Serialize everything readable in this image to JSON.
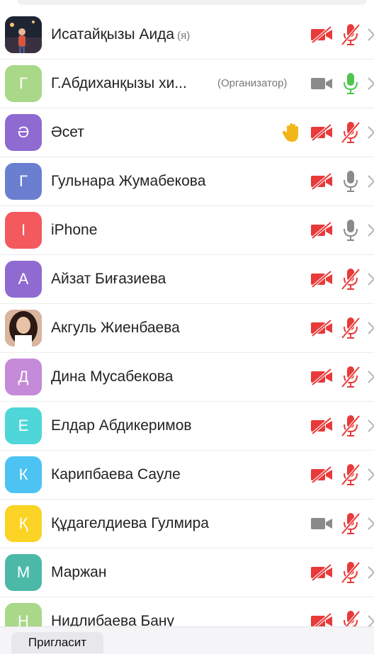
{
  "participants": [
    {
      "name": "Исатайқызы Аида",
      "tag": "(я)",
      "avatar_letter": "",
      "avatar_color": "#2a2f3d",
      "photo": true,
      "video": "off",
      "mic": "muted"
    },
    {
      "name": "Г.Абдиханқызы  хи...",
      "role": "(Организатор)",
      "avatar_letter": "Г",
      "avatar_color": "#a8d888",
      "video": "on",
      "mic": "active"
    },
    {
      "name": "Әсет",
      "avatar_letter": "Ә",
      "avatar_color": "#8e6ad1",
      "hand": true,
      "video": "off",
      "mic": "muted"
    },
    {
      "name": "Гульнара Жумабекова",
      "avatar_letter": "Г",
      "avatar_color": "#6b7fd1",
      "video": "off",
      "mic": "on"
    },
    {
      "name": "iPhone",
      "avatar_letter": "I",
      "avatar_color": "#f4595e",
      "video": "off",
      "mic": "on"
    },
    {
      "name": "Айзат Биғазиева",
      "avatar_letter": "А",
      "avatar_color": "#8e6ad1",
      "video": "off",
      "mic": "muted"
    },
    {
      "name": "Акгуль Жиенбаева",
      "avatar_letter": "",
      "avatar_color": "#c99a82",
      "photo": true,
      "video": "off",
      "mic": "muted"
    },
    {
      "name": "Дина Мусабекова",
      "avatar_letter": "Д",
      "avatar_color": "#c58ad8",
      "video": "off",
      "mic": "muted"
    },
    {
      "name": "Елдар Абдикеримов",
      "avatar_letter": "Е",
      "avatar_color": "#4fd6d8",
      "video": "off",
      "mic": "muted"
    },
    {
      "name": "Карипбаева Сауле",
      "avatar_letter": "К",
      "avatar_color": "#4cc3f2",
      "video": "off",
      "mic": "muted"
    },
    {
      "name": "Құдагелдиева Гулмира",
      "avatar_letter": "Қ",
      "avatar_color": "#fbd324",
      "video": "on",
      "mic": "muted"
    },
    {
      "name": "Маржан",
      "avatar_letter": "М",
      "avatar_color": "#4cb8a8",
      "video": "off",
      "mic": "muted"
    },
    {
      "name": "Нидлибаева Бану",
      "avatar_letter": "Н",
      "avatar_color": "#a8d888",
      "video": "off",
      "mic": "muted"
    }
  ],
  "footer": {
    "invite_label": "Пригласит"
  },
  "colors": {
    "muted_red": "#e83a3a",
    "active_green": "#4cc74c",
    "neutral_gray": "#8a8a8a",
    "hand_yellow": "#f2b619"
  }
}
